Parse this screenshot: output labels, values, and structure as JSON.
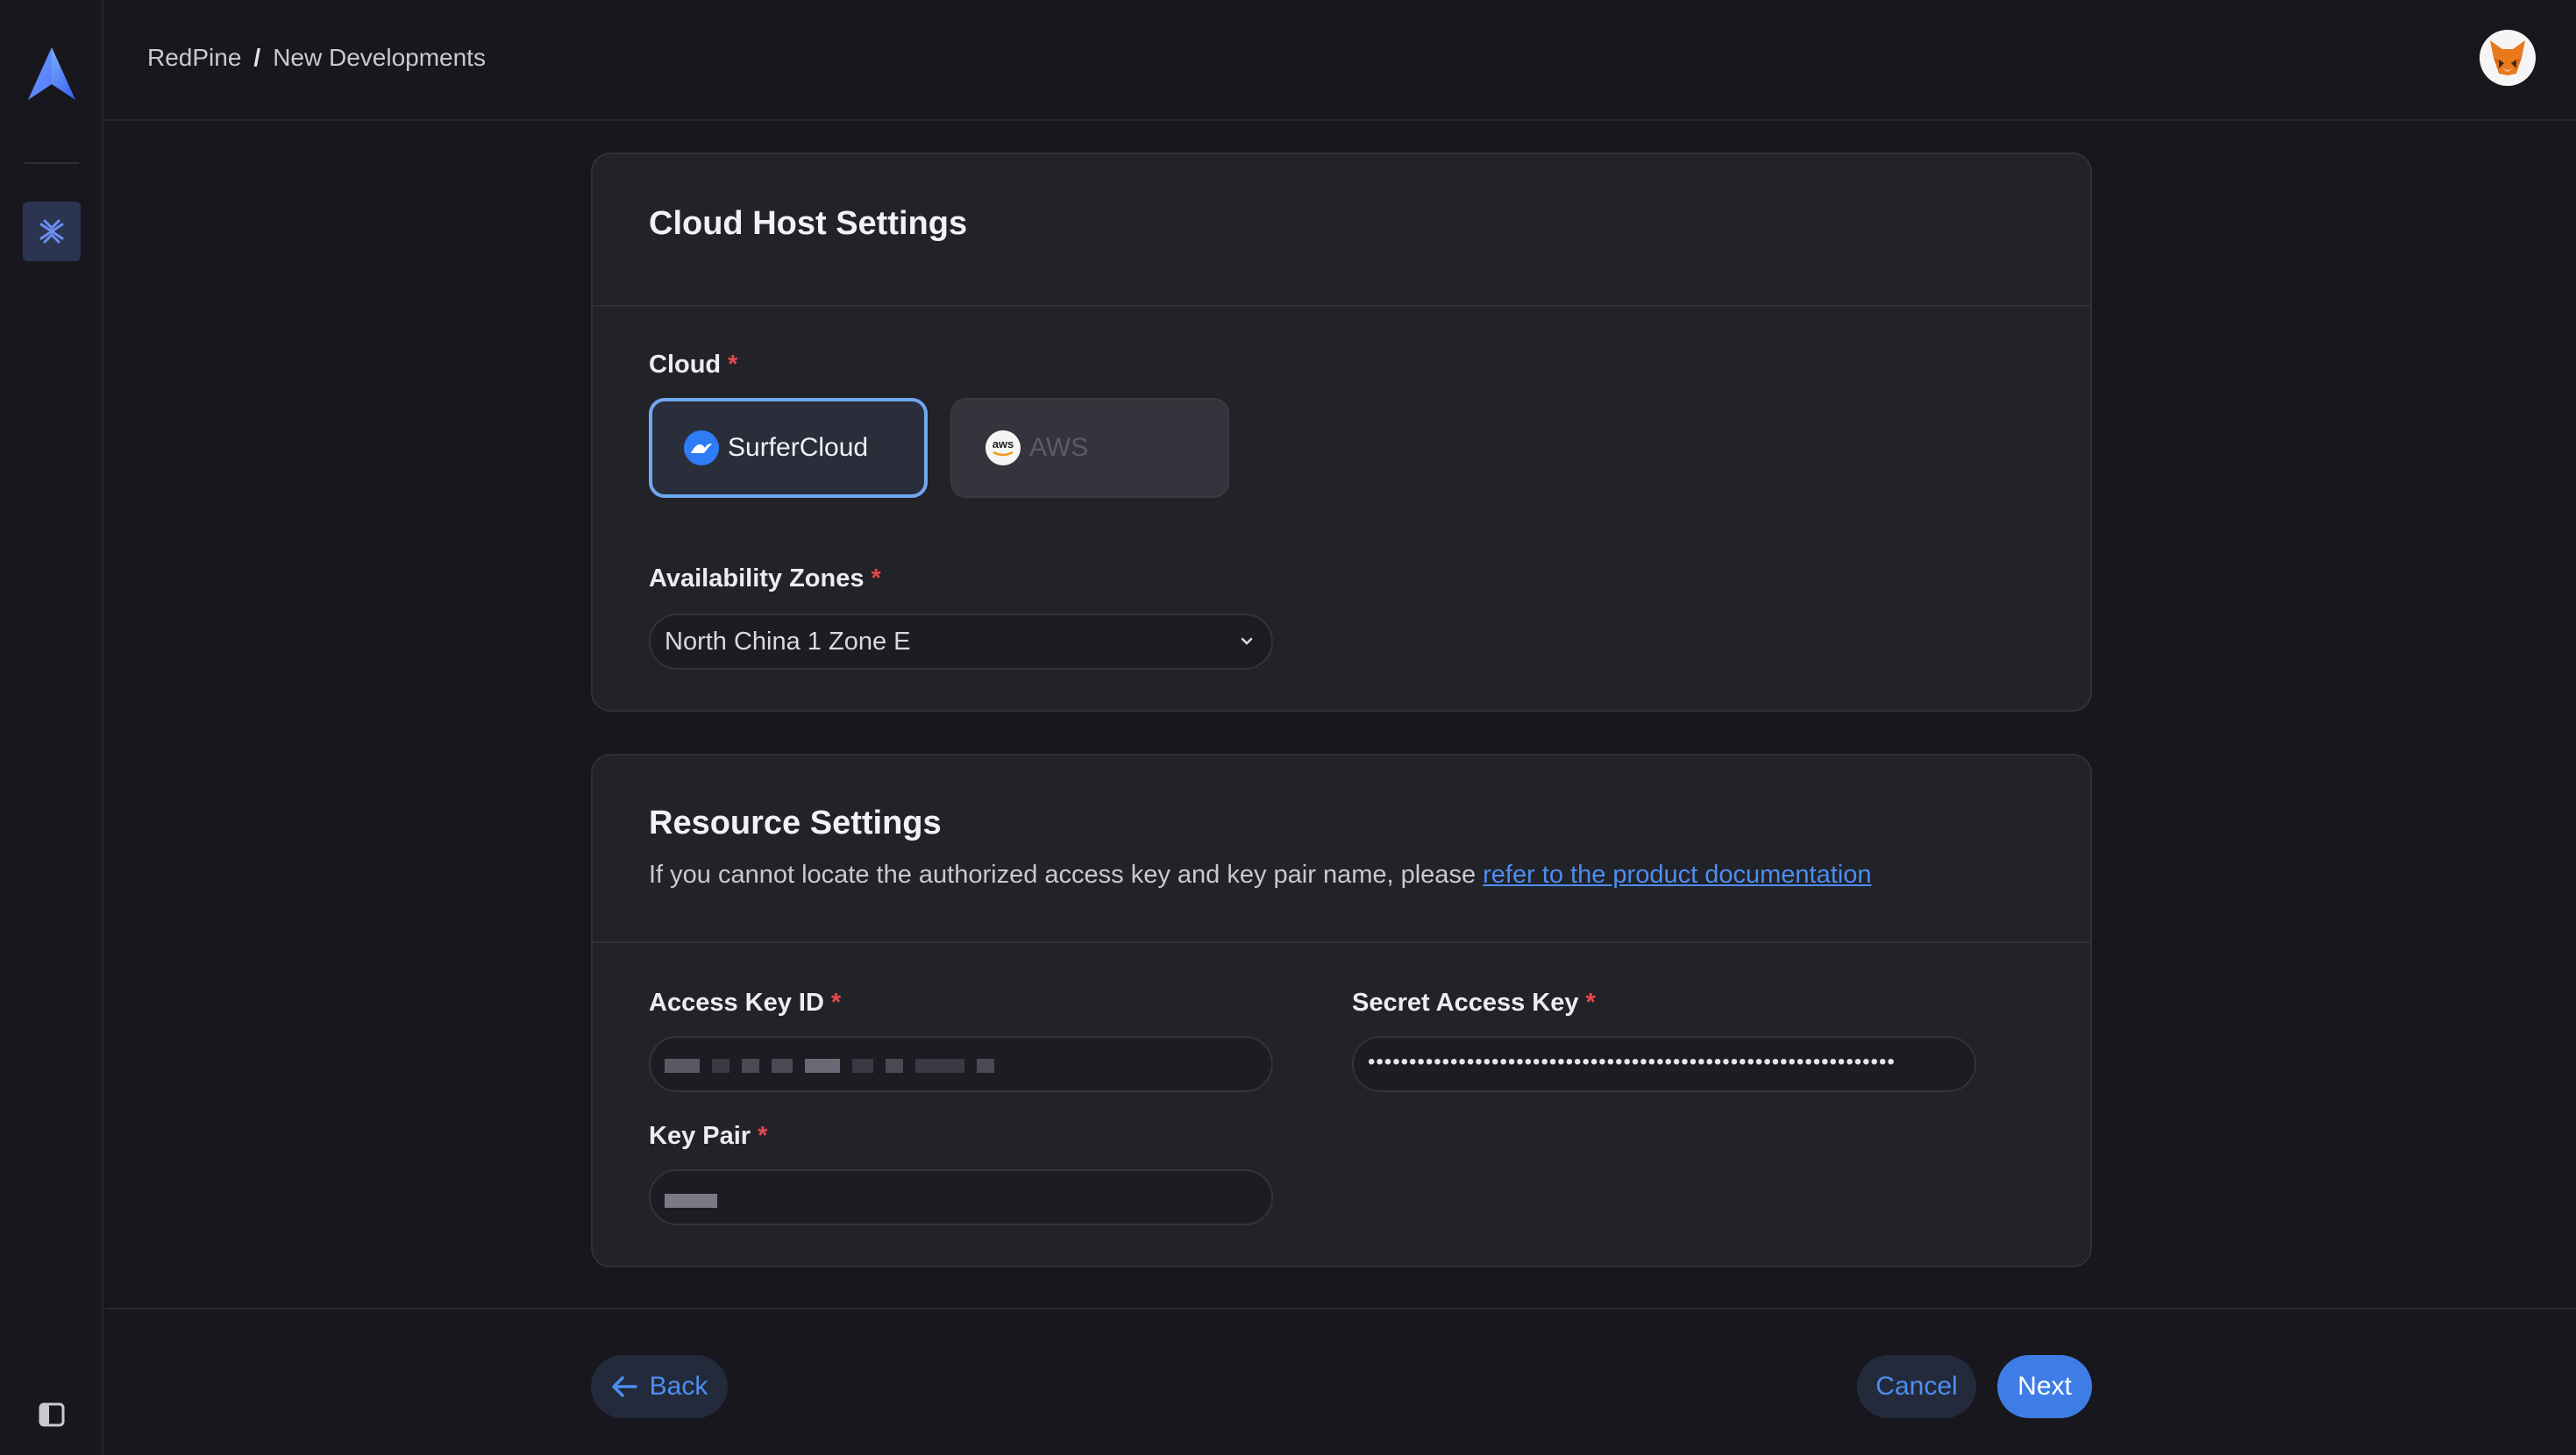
{
  "header": {
    "breadcrumb": [
      "RedPine",
      "New Developments"
    ],
    "breadcrumb_separator": "/"
  },
  "cloud_host_settings": {
    "title": "Cloud Host Settings",
    "cloud_label": "Cloud",
    "required_mark": "*",
    "options": [
      {
        "label": "SurferCloud",
        "icon": "surfercloud-icon",
        "selected": true
      },
      {
        "label": "AWS",
        "icon": "aws-icon",
        "selected": false,
        "disabled": true
      }
    ],
    "zones_label": "Availability Zones",
    "zone_value": "North China 1 Zone E"
  },
  "resource_settings": {
    "title": "Resource Settings",
    "description": "If you cannot locate the authorized access key and key pair name, please ",
    "doc_link": "refer to the product documentation",
    "access_key_label": "Access Key ID",
    "secret_key_label": "Secret Access Key",
    "secret_key_value": "••••••••••••••••••••••••••••••••••••••••••••••••••••••••••••••••",
    "key_pair_label": "Key Pair"
  },
  "footer": {
    "back_label": "Back",
    "cancel_label": "Cancel",
    "next_label": "Next"
  },
  "colors": {
    "accent": "#3f7de6",
    "link": "#4d8ef0",
    "required": "#e5484d",
    "selected_border": "#6fa8ef"
  }
}
